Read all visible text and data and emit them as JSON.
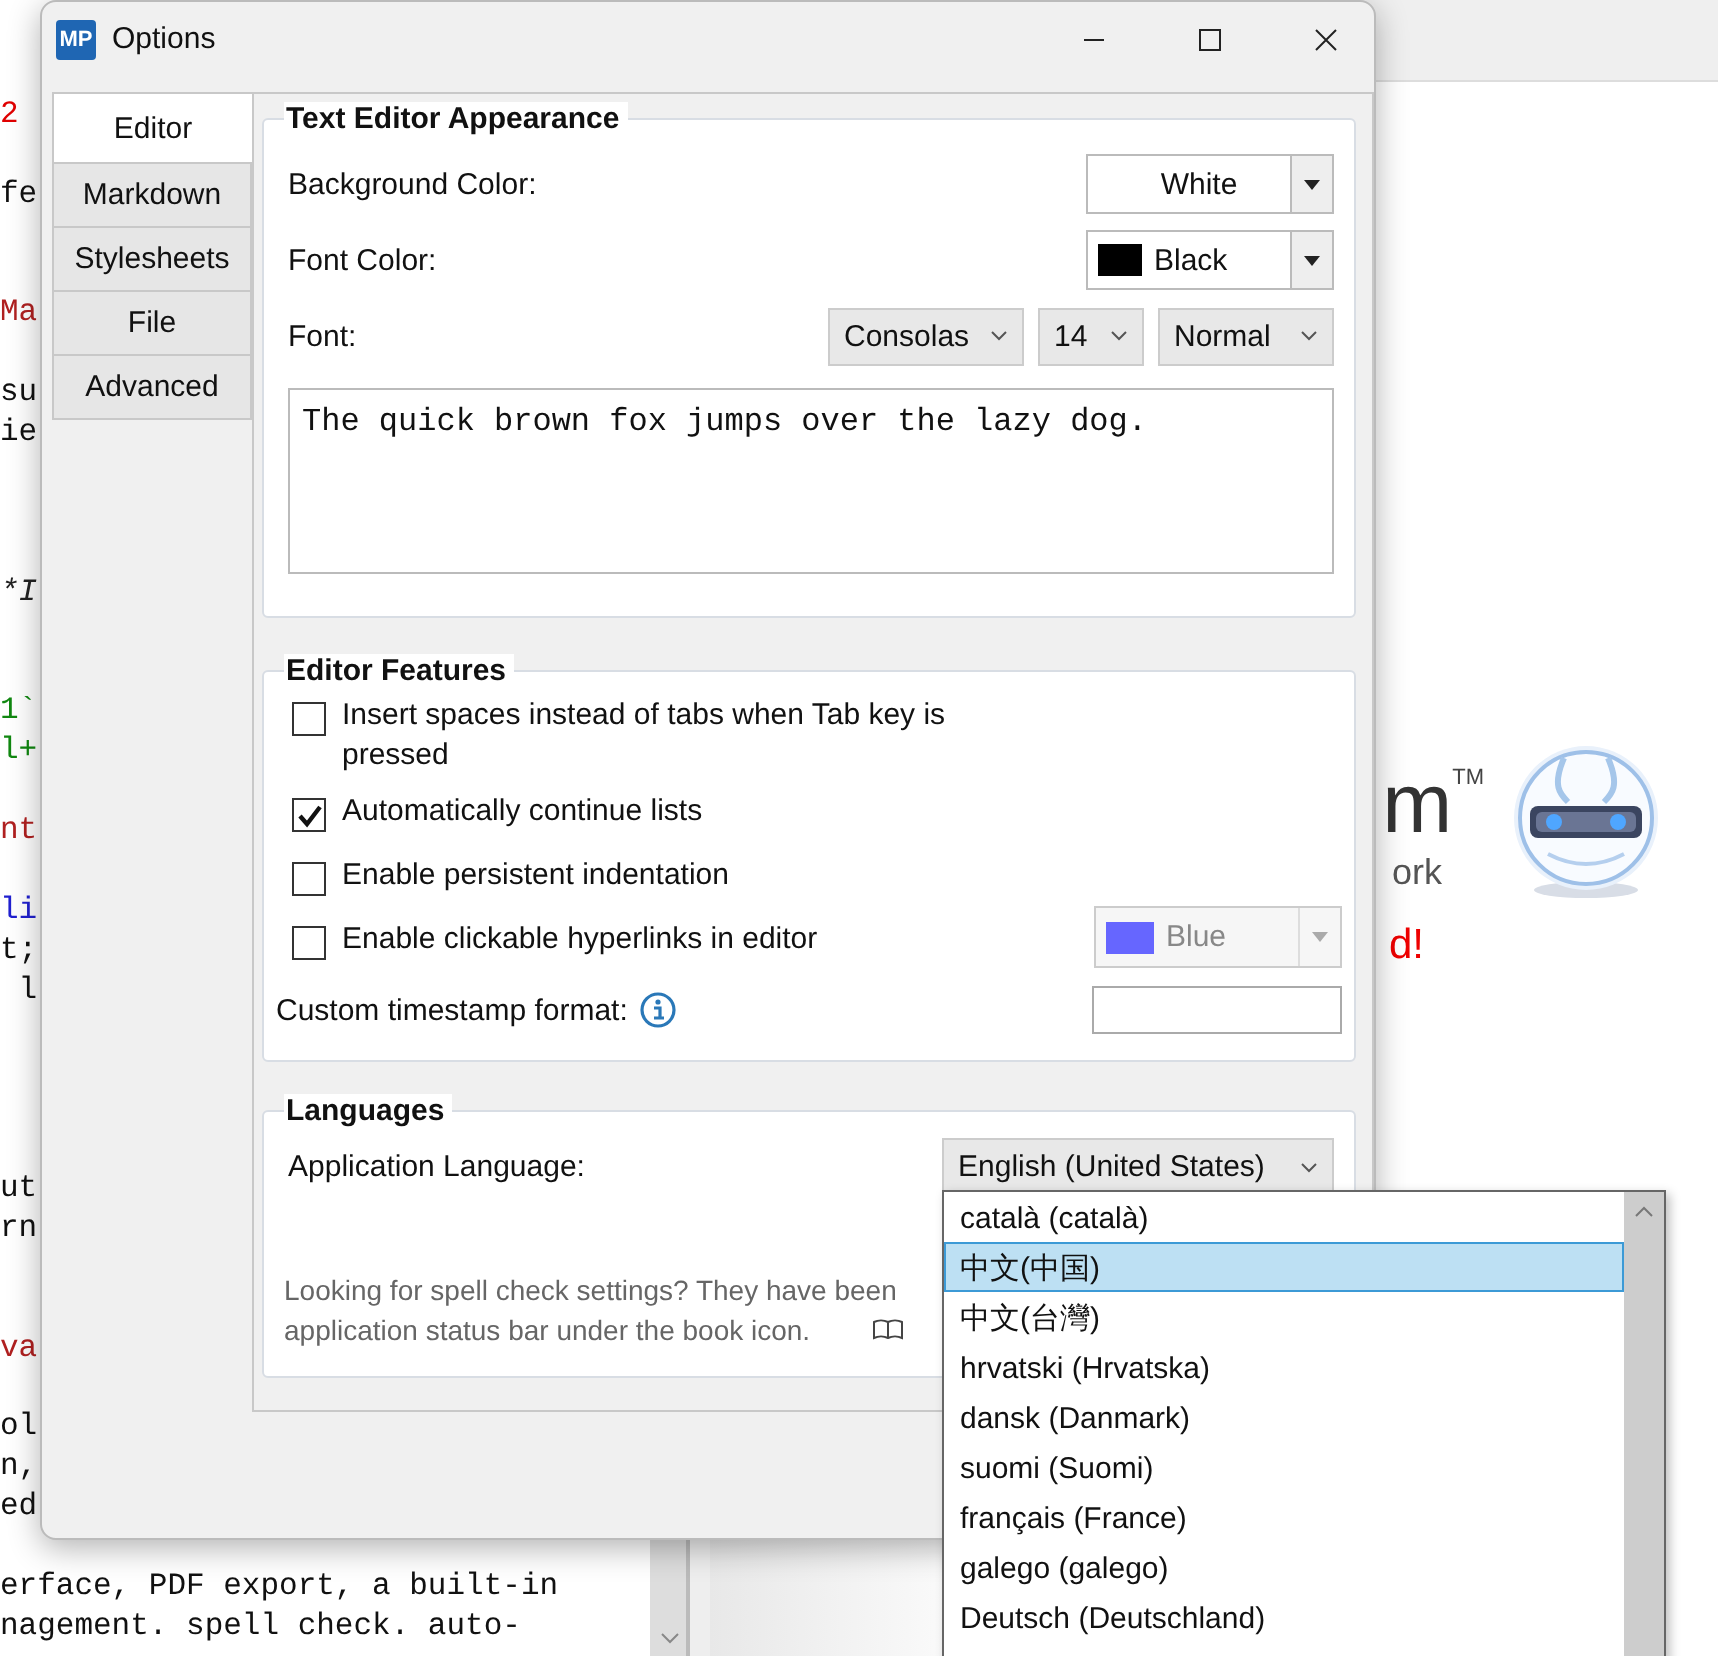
{
  "background_app": {
    "editor_lines": [
      {
        "text": "2",
        "kind": "heading"
      },
      {
        "text": "fe",
        "kind": "plain"
      },
      {
        "text": "Ma",
        "kind": "marker"
      },
      {
        "text": "su",
        "kind": "plain"
      },
      {
        "text": "ie",
        "kind": "plain"
      },
      {
        "text": "*I",
        "kind": "emphasis"
      },
      {
        "text": "1`",
        "kind": "code"
      },
      {
        "text": "l+",
        "kind": "code"
      },
      {
        "text": "nt",
        "kind": "marker"
      },
      {
        "text": "li",
        "kind": "link"
      },
      {
        "text": "t;",
        "kind": "plain"
      },
      {
        "text": " l",
        "kind": "plain"
      },
      {
        "text": "ut",
        "kind": "plain"
      },
      {
        "text": "rn",
        "kind": "plain"
      },
      {
        "text": "va",
        "kind": "marker"
      },
      {
        "text": "ol",
        "kind": "plain"
      },
      {
        "text": "n,",
        "kind": "plain"
      },
      {
        "text": "ed",
        "kind": "plain"
      },
      {
        "text": "erface, PDF export, a built-in",
        "kind": "plain"
      },
      {
        "text": "nagement. spell check. auto-",
        "kind": "plain"
      }
    ],
    "preview": {
      "logo": "m",
      "logo_mark": "TM",
      "tagline": "ork",
      "notice": "d!"
    }
  },
  "window": {
    "title": "Options",
    "app_icon": "MP"
  },
  "tabs": [
    {
      "label": "Editor",
      "selected": true
    },
    {
      "label": "Markdown",
      "selected": false
    },
    {
      "label": "Stylesheets",
      "selected": false
    },
    {
      "label": "File",
      "selected": false
    },
    {
      "label": "Advanced",
      "selected": false
    }
  ],
  "appearance": {
    "title": "Text Editor Appearance",
    "background_color": {
      "label": "Background Color:",
      "value": "White"
    },
    "font_color": {
      "label": "Font Color:",
      "value": "Black",
      "color": "#000000"
    },
    "font": {
      "label": "Font:",
      "family": "Consolas",
      "size": "14",
      "weight": "Normal"
    },
    "preview_text": "The quick brown fox jumps over the lazy dog."
  },
  "features": {
    "title": "Editor Features",
    "options": [
      {
        "label": "Insert spaces instead of tabs when Tab key is pressed",
        "checked": false
      },
      {
        "label": "Automatically continue lists",
        "checked": true
      },
      {
        "label": "Enable persistent indentation",
        "checked": false
      },
      {
        "label": "Enable clickable hyperlinks in editor",
        "checked": false
      }
    ],
    "link_color": {
      "value": "Blue",
      "color": "#6666ff",
      "disabled": true
    },
    "timestamp": {
      "label": "Custom timestamp format:"
    }
  },
  "languages": {
    "title": "Languages",
    "label": "Application Language:",
    "value": "English (United States)",
    "hint_lines": [
      "Looking for spell check settings? They have been",
      "application status bar under the book icon."
    ]
  },
  "language_dropdown": {
    "items": [
      {
        "label": "català (català)",
        "selected": false
      },
      {
        "label": "中文(中国)",
        "selected": true
      },
      {
        "label": "中文(台灣)",
        "selected": false
      },
      {
        "label": "hrvatski (Hrvatska)",
        "selected": false
      },
      {
        "label": "dansk (Danmark)",
        "selected": false
      },
      {
        "label": "suomi (Suomi)",
        "selected": false
      },
      {
        "label": "français (France)",
        "selected": false
      },
      {
        "label": "galego (galego)",
        "selected": false
      },
      {
        "label": "Deutsch (Deutschland)",
        "selected": false
      }
    ]
  }
}
